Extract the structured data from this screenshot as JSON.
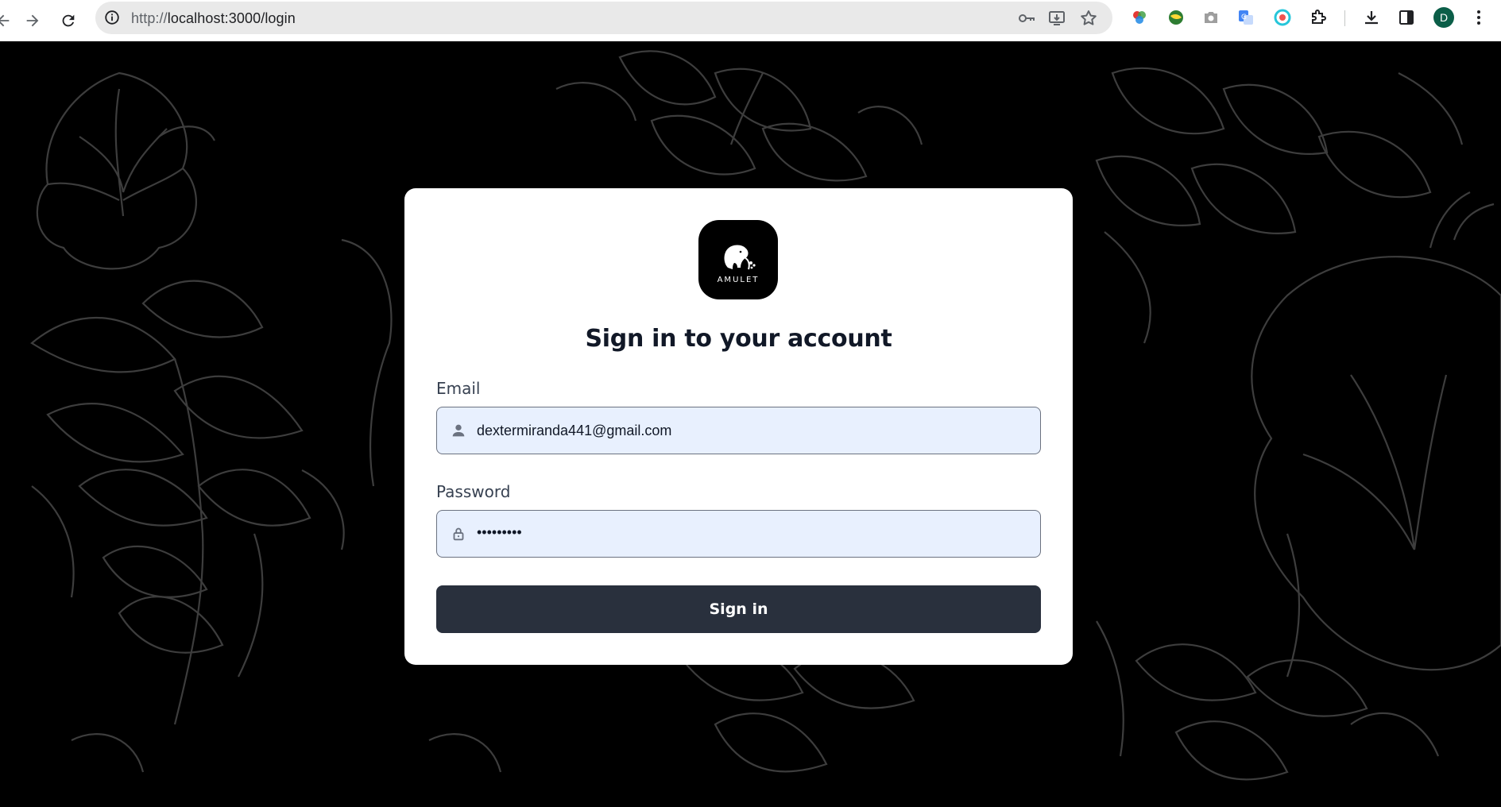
{
  "browser": {
    "url_prefix": "http://",
    "url_host": "localhost:3000/login",
    "profile_initial": "D"
  },
  "login": {
    "logo_text": "AMULET",
    "title": "Sign in to your account",
    "email_label": "Email",
    "email_value": "dextermiranda441@gmail.com",
    "password_label": "Password",
    "password_value": "•••••••••",
    "submit_label": "Sign in"
  },
  "colors": {
    "field_bg": "#e8f0fe",
    "button_bg": "#29303d",
    "page_bg": "#000000"
  }
}
